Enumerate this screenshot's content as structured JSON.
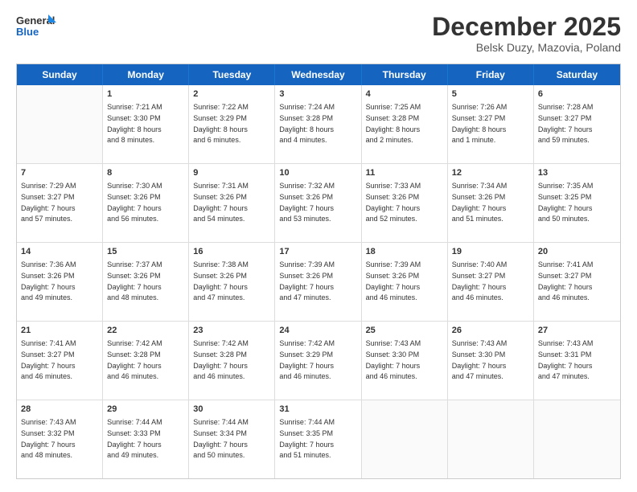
{
  "header": {
    "logo_general": "General",
    "logo_blue": "Blue",
    "month": "December 2025",
    "location": "Belsk Duzy, Mazovia, Poland"
  },
  "days_of_week": [
    "Sunday",
    "Monday",
    "Tuesday",
    "Wednesday",
    "Thursday",
    "Friday",
    "Saturday"
  ],
  "weeks": [
    [
      {
        "day": "",
        "text": ""
      },
      {
        "day": "1",
        "text": "Sunrise: 7:21 AM\nSunset: 3:30 PM\nDaylight: 8 hours\nand 8 minutes."
      },
      {
        "day": "2",
        "text": "Sunrise: 7:22 AM\nSunset: 3:29 PM\nDaylight: 8 hours\nand 6 minutes."
      },
      {
        "day": "3",
        "text": "Sunrise: 7:24 AM\nSunset: 3:28 PM\nDaylight: 8 hours\nand 4 minutes."
      },
      {
        "day": "4",
        "text": "Sunrise: 7:25 AM\nSunset: 3:28 PM\nDaylight: 8 hours\nand 2 minutes."
      },
      {
        "day": "5",
        "text": "Sunrise: 7:26 AM\nSunset: 3:27 PM\nDaylight: 8 hours\nand 1 minute."
      },
      {
        "day": "6",
        "text": "Sunrise: 7:28 AM\nSunset: 3:27 PM\nDaylight: 7 hours\nand 59 minutes."
      }
    ],
    [
      {
        "day": "7",
        "text": "Sunrise: 7:29 AM\nSunset: 3:27 PM\nDaylight: 7 hours\nand 57 minutes."
      },
      {
        "day": "8",
        "text": "Sunrise: 7:30 AM\nSunset: 3:26 PM\nDaylight: 7 hours\nand 56 minutes."
      },
      {
        "day": "9",
        "text": "Sunrise: 7:31 AM\nSunset: 3:26 PM\nDaylight: 7 hours\nand 54 minutes."
      },
      {
        "day": "10",
        "text": "Sunrise: 7:32 AM\nSunset: 3:26 PM\nDaylight: 7 hours\nand 53 minutes."
      },
      {
        "day": "11",
        "text": "Sunrise: 7:33 AM\nSunset: 3:26 PM\nDaylight: 7 hours\nand 52 minutes."
      },
      {
        "day": "12",
        "text": "Sunrise: 7:34 AM\nSunset: 3:26 PM\nDaylight: 7 hours\nand 51 minutes."
      },
      {
        "day": "13",
        "text": "Sunrise: 7:35 AM\nSunset: 3:25 PM\nDaylight: 7 hours\nand 50 minutes."
      }
    ],
    [
      {
        "day": "14",
        "text": "Sunrise: 7:36 AM\nSunset: 3:26 PM\nDaylight: 7 hours\nand 49 minutes."
      },
      {
        "day": "15",
        "text": "Sunrise: 7:37 AM\nSunset: 3:26 PM\nDaylight: 7 hours\nand 48 minutes."
      },
      {
        "day": "16",
        "text": "Sunrise: 7:38 AM\nSunset: 3:26 PM\nDaylight: 7 hours\nand 47 minutes."
      },
      {
        "day": "17",
        "text": "Sunrise: 7:39 AM\nSunset: 3:26 PM\nDaylight: 7 hours\nand 47 minutes."
      },
      {
        "day": "18",
        "text": "Sunrise: 7:39 AM\nSunset: 3:26 PM\nDaylight: 7 hours\nand 46 minutes."
      },
      {
        "day": "19",
        "text": "Sunrise: 7:40 AM\nSunset: 3:27 PM\nDaylight: 7 hours\nand 46 minutes."
      },
      {
        "day": "20",
        "text": "Sunrise: 7:41 AM\nSunset: 3:27 PM\nDaylight: 7 hours\nand 46 minutes."
      }
    ],
    [
      {
        "day": "21",
        "text": "Sunrise: 7:41 AM\nSunset: 3:27 PM\nDaylight: 7 hours\nand 46 minutes."
      },
      {
        "day": "22",
        "text": "Sunrise: 7:42 AM\nSunset: 3:28 PM\nDaylight: 7 hours\nand 46 minutes."
      },
      {
        "day": "23",
        "text": "Sunrise: 7:42 AM\nSunset: 3:28 PM\nDaylight: 7 hours\nand 46 minutes."
      },
      {
        "day": "24",
        "text": "Sunrise: 7:42 AM\nSunset: 3:29 PM\nDaylight: 7 hours\nand 46 minutes."
      },
      {
        "day": "25",
        "text": "Sunrise: 7:43 AM\nSunset: 3:30 PM\nDaylight: 7 hours\nand 46 minutes."
      },
      {
        "day": "26",
        "text": "Sunrise: 7:43 AM\nSunset: 3:30 PM\nDaylight: 7 hours\nand 47 minutes."
      },
      {
        "day": "27",
        "text": "Sunrise: 7:43 AM\nSunset: 3:31 PM\nDaylight: 7 hours\nand 47 minutes."
      }
    ],
    [
      {
        "day": "28",
        "text": "Sunrise: 7:43 AM\nSunset: 3:32 PM\nDaylight: 7 hours\nand 48 minutes."
      },
      {
        "day": "29",
        "text": "Sunrise: 7:44 AM\nSunset: 3:33 PM\nDaylight: 7 hours\nand 49 minutes."
      },
      {
        "day": "30",
        "text": "Sunrise: 7:44 AM\nSunset: 3:34 PM\nDaylight: 7 hours\nand 50 minutes."
      },
      {
        "day": "31",
        "text": "Sunrise: 7:44 AM\nSunset: 3:35 PM\nDaylight: 7 hours\nand 51 minutes."
      },
      {
        "day": "",
        "text": ""
      },
      {
        "day": "",
        "text": ""
      },
      {
        "day": "",
        "text": ""
      }
    ]
  ]
}
